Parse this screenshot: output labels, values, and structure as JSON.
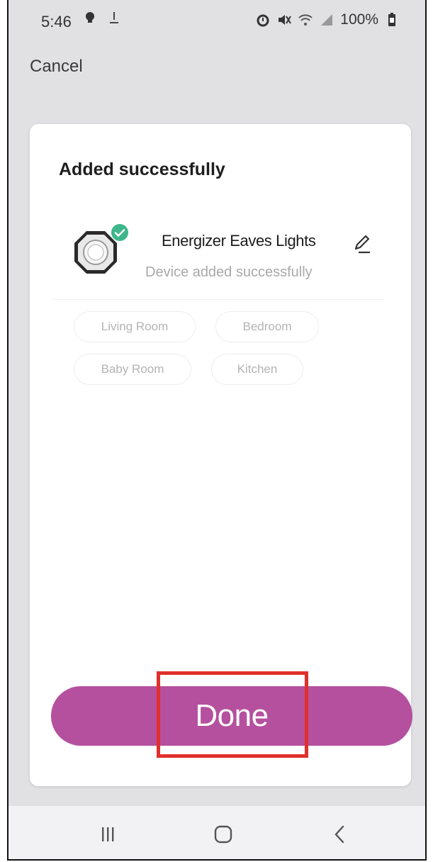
{
  "status_bar": {
    "time": "5:46",
    "battery": "100%",
    "icons": [
      "lightbulb-icon",
      "download-icon",
      "alarm-icon",
      "mute-icon",
      "wifi-icon",
      "signal-icon",
      "battery-icon"
    ]
  },
  "header": {
    "cancel_label": "Cancel"
  },
  "card": {
    "title": "Added successfully",
    "device": {
      "name": "Energizer Eaves Lights",
      "status": "Device added successfully",
      "icons": [
        "device-icon",
        "check-icon",
        "edit-pencil-icon"
      ]
    },
    "rooms": [
      "Living Room",
      "Bedroom",
      "Baby Room",
      "Kitchen"
    ]
  },
  "actions": {
    "done_label": "Done"
  },
  "nav_bar": {
    "buttons": [
      "recents-icon",
      "home-icon",
      "back-icon"
    ]
  },
  "colors": {
    "accent": "#b5509f",
    "highlight": "#e0302b",
    "success": "#3fb68b",
    "background": "#e1e1e3"
  }
}
